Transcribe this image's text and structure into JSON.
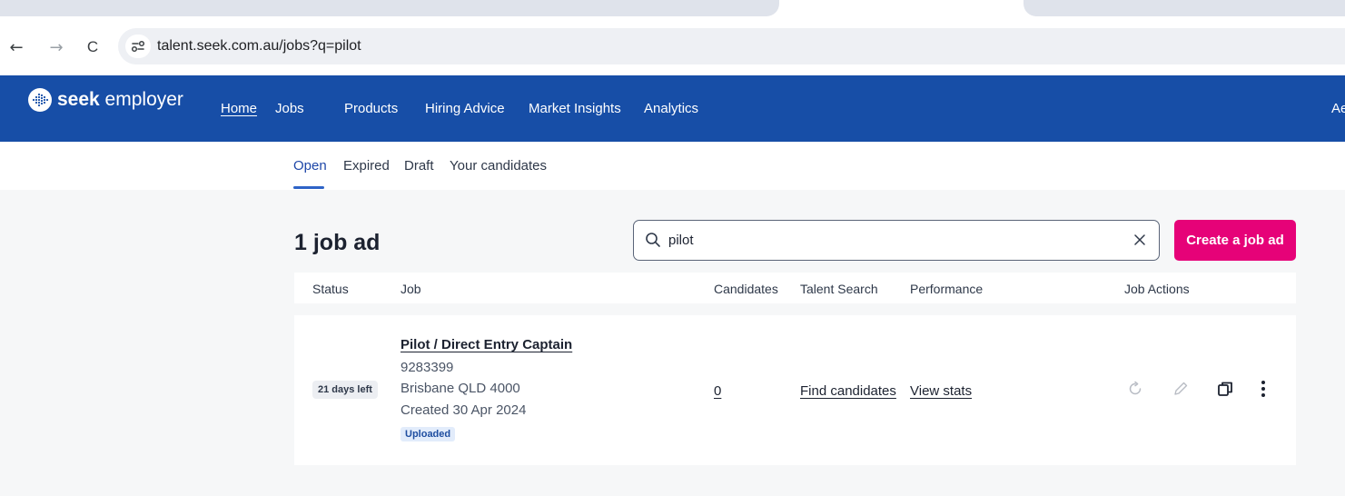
{
  "browser": {
    "back_glyph": "←",
    "forward_glyph": "→",
    "reload_glyph": "C",
    "url": "talent.seek.com.au/jobs?q=pilot"
  },
  "header": {
    "brand_bold": "seek",
    "brand_rest": " employer",
    "nav": [
      "Home",
      "Jobs",
      "Products",
      "Hiring Advice",
      "Market Insights",
      "Analytics"
    ],
    "account_partial": "Ae"
  },
  "subtabs": [
    "Open",
    "Expired",
    "Draft",
    "Your candidates"
  ],
  "main": {
    "count_title": "1 job ad",
    "search_value": "pilot",
    "clear_glyph": "×",
    "create_button": "Create a job ad"
  },
  "table": {
    "columns": [
      "Status",
      "Job",
      "Candidates",
      "Talent Search",
      "Performance",
      "Job Actions"
    ],
    "rows": [
      {
        "status": "21 days left",
        "title": "Pilot / Direct Entry Captain",
        "reference": "9283399",
        "location": "Brisbane QLD 4000",
        "created": "Created 30 Apr 2024",
        "badge": "Uploaded",
        "candidates": "0",
        "talent_search": "Find candidates",
        "performance": "View stats",
        "actions": [
          "refresh-icon",
          "edit-icon",
          "copy-icon",
          "more-icon"
        ]
      }
    ]
  },
  "colors": {
    "brand_blue": "#174ea7",
    "create_pink": "#e60278",
    "active_tab": "#1e47a8"
  }
}
